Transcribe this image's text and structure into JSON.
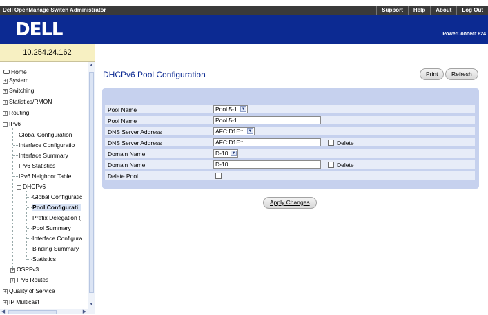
{
  "topbar": {
    "app_title": "Dell OpenManage Switch Administrator",
    "links": [
      "Support",
      "Help",
      "About",
      "Log Out"
    ]
  },
  "header": {
    "logo": "DELL",
    "product": "PowerConnect 624"
  },
  "left": {
    "ip": "10.254.24.162",
    "nav": [
      {
        "label": "Home",
        "icon": "home-icon"
      },
      {
        "label": "System",
        "icon": "expand-icon"
      },
      {
        "label": "Switching",
        "icon": "expand-icon"
      },
      {
        "label": "Statistics/RMON",
        "icon": "expand-icon"
      },
      {
        "label": "Routing",
        "icon": "expand-icon"
      },
      {
        "label": "IPv6",
        "icon": "collapse-icon"
      },
      {
        "label": "Global Configuration"
      },
      {
        "label": "Interface Configuratio"
      },
      {
        "label": "Interface Summary"
      },
      {
        "label": "IPv6 Statistics"
      },
      {
        "label": "IPv6 Neighbor Table"
      },
      {
        "label": "DHCPv6",
        "icon": "collapse-icon"
      },
      {
        "label": "Global Configuratic"
      },
      {
        "label": "Pool Configurati",
        "selected": true
      },
      {
        "label": "Prefix Delegation ("
      },
      {
        "label": "Pool Summary"
      },
      {
        "label": "Interface Configura"
      },
      {
        "label": "Binding Summary"
      },
      {
        "label": "Statistics"
      },
      {
        "label": "OSPFv3",
        "icon": "expand-icon"
      },
      {
        "label": "IPv6 Routes",
        "icon": "expand-icon"
      },
      {
        "label": "Quality of Service",
        "icon": "expand-icon"
      },
      {
        "label": "IP Multicast",
        "icon": "expand-icon"
      }
    ]
  },
  "main": {
    "title": "DHCPv6 Pool Configuration",
    "print_label": "Print",
    "refresh_label": "Refresh",
    "apply_label": "Apply Changes",
    "delete_label": "Delete",
    "rows": {
      "pool_name_select": {
        "label": "Pool Name",
        "value": "Pool 5-1"
      },
      "pool_name_text": {
        "label": "Pool Name",
        "value": "Pool 5-1"
      },
      "dns_select": {
        "label": "DNS Server Address",
        "value": "AFC:D1E::"
      },
      "dns_text": {
        "label": "DNS Server Address",
        "value": "AFC:D1E::"
      },
      "domain_select": {
        "label": "Domain Name",
        "value": "D-10"
      },
      "domain_text": {
        "label": "Domain Name",
        "value": "D-10"
      },
      "delete_pool": {
        "label": "Delete Pool"
      }
    }
  }
}
